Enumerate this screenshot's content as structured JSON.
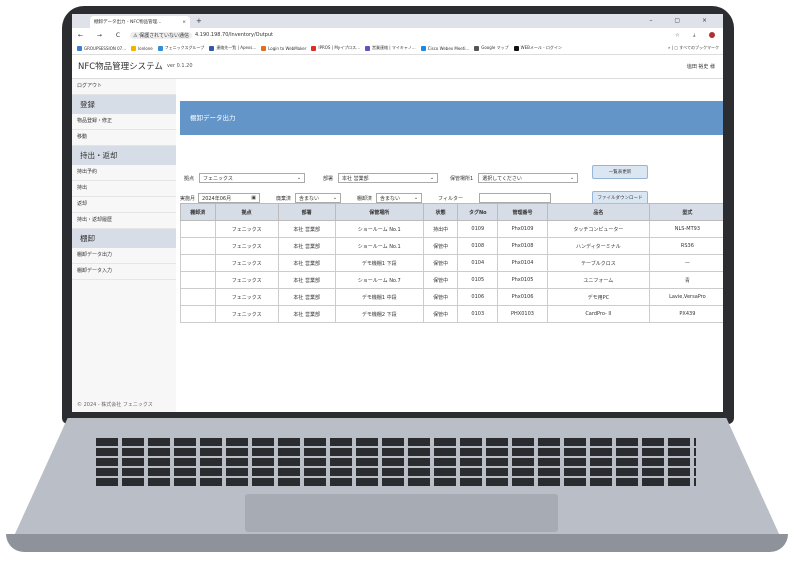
{
  "browser": {
    "tab_title": "棚卸データ出力 - NFC物品管理...",
    "tab_close": "×",
    "new_tab": "+",
    "window_controls": "–  ▢  ×",
    "nav": "← → C",
    "security_warning": "⚠ 保護されていない通信",
    "url": "4.190.198.70/Inventory/Output",
    "addr_icons": "☆ ⤓",
    "bookmarks": [
      "GROUPSESSION 07...",
      "lonlone",
      "フェニックスグループ",
      "連絡先一覧 | Apexs...",
      "Login to WebMaker",
      "IPROS | Myイプロス...",
      "営業連絡 | マイキャノ...",
      "Cisco Webex Meeti...",
      "Google マップ",
      "WEBメール - ログイン"
    ],
    "bookmark_colors": [
      "#3a7bd5",
      "#f0b400",
      "#2f8fdd",
      "#3358a8",
      "#e07020",
      "#d93025",
      "#6a4fc2",
      "#1e88e5",
      "#555555",
      "#111111"
    ],
    "bookmarks_right": "»  |  ▢ すべてのブックマーク"
  },
  "app": {
    "title": "NFC物品管理システム",
    "version": "ver 0.1.20",
    "user": "塩田 裕史 様",
    "copyright": "© 2024 - 株式会社 フェニックス",
    "accent": "#6495c8"
  },
  "sidebar": {
    "logout": "ログアウト",
    "sections": [
      {
        "header": "登録",
        "items": [
          "物品登録・修正",
          "移動"
        ]
      },
      {
        "header": "持出・返却",
        "items": [
          "持出予約",
          "持出",
          "返却",
          "持出・返却履歴"
        ]
      },
      {
        "header": "棚卸",
        "items": [
          "棚卸データ出力",
          "棚卸データ入力"
        ]
      }
    ]
  },
  "main": {
    "banner": "棚卸データ出力",
    "filters": {
      "base_label": "拠点",
      "base_value": "フェニックス",
      "dept_label": "部署",
      "dept_value": "本社 営業部",
      "storage_label": "保管場所1",
      "storage_value": "選択してください",
      "date_label": "実施月",
      "date_value": "2024年06月",
      "disposed_label": "廃棄済",
      "disposed_value": "含まない",
      "inventoried_label": "棚卸済",
      "inventoried_value": "含まない",
      "filter_label": "フィルター",
      "filter_value": ""
    },
    "refresh_button": "一覧表更新",
    "download_button": "ファイルダウンロード",
    "table": {
      "headers": [
        "棚卸済",
        "拠点",
        "部署",
        "保管場所",
        "状態",
        "タグNo",
        "管理番号",
        "品名",
        "型式"
      ],
      "rows": [
        [
          "",
          "フェニックス",
          "本社 営業部",
          "ショールーム No.1",
          "持出中",
          "0109",
          "Phx0109",
          "タッチコンピューター",
          "NLS-MT93"
        ],
        [
          "",
          "フェニックス",
          "本社 営業部",
          "ショールーム No.1",
          "保管中",
          "0108",
          "Phx0108",
          "ハンディターミナル",
          "RS36"
        ],
        [
          "",
          "フェニックス",
          "本社 営業部",
          "デモ機棚1 下段",
          "保管中",
          "0104",
          "Phx0104",
          "テーブルクロス",
          "—"
        ],
        [
          "",
          "フェニックス",
          "本社 営業部",
          "ショールーム No.7",
          "保管中",
          "0105",
          "Phx0105",
          "ユニフォーム",
          "青"
        ],
        [
          "",
          "フェニックス",
          "本社 営業部",
          "デモ機棚1 中段",
          "保管中",
          "0106",
          "Phx0106",
          "デモ用PC",
          "Lavie,VersaPro"
        ],
        [
          "",
          "フェニックス",
          "本社 営業部",
          "デモ機棚2 下段",
          "保管中",
          "0103",
          "PHX0103",
          "CardPro- II",
          "PX439"
        ]
      ]
    }
  }
}
